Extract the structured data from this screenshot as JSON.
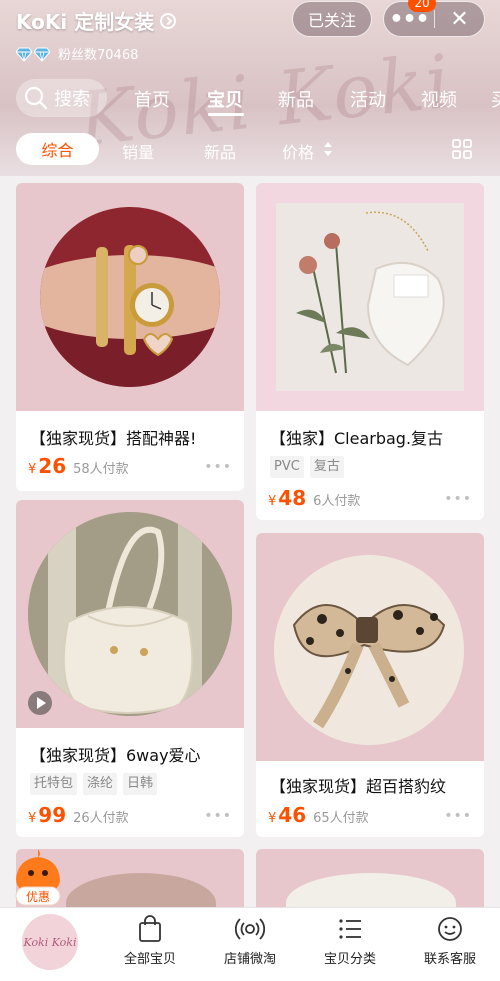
{
  "header": {
    "shop_name": "KoKi 定制女装",
    "follow_label": "已关注",
    "more_label": "•••",
    "badge_count": "20",
    "close_label": "✕",
    "fans_label": "粉丝数70468",
    "watermark": "Koki Koki"
  },
  "search": {
    "label": "搜索"
  },
  "nav_tabs": [
    "首页",
    "宝贝",
    "新品",
    "活动",
    "视频",
    "买"
  ],
  "active_tab": "宝贝",
  "sort": {
    "items": [
      "综合",
      "销量",
      "新品",
      "价格"
    ],
    "active": "综合"
  },
  "products": [
    {
      "title": "【独家现货】搭配神器!",
      "tags": [],
      "currency": "¥",
      "price": "26",
      "sold": "58人付款",
      "more": "•••"
    },
    {
      "title": "【独家】Clearbag.复古",
      "tags": [
        "PVC",
        "复古"
      ],
      "currency": "¥",
      "price": "48",
      "sold": "6人付款",
      "more": "•••"
    },
    {
      "title": "【独家现货】6way爱心",
      "tags": [
        "托特包",
        "涤纶",
        "日韩"
      ],
      "currency": "¥",
      "price": "99",
      "sold": "26人付款",
      "more": "•••"
    },
    {
      "title": "【独家现货】超百搭豹纹",
      "tags": [],
      "currency": "¥",
      "price": "46",
      "sold": "65人付款",
      "more": "•••"
    }
  ],
  "coupon": {
    "label": "优惠"
  },
  "bottom_bar": {
    "logo_text": "Koki Koki",
    "items": [
      "全部宝贝",
      "店铺微淘",
      "宝贝分类",
      "联系客服"
    ]
  },
  "colors": {
    "accent": "#ff5000",
    "card_pink": "#ecc9ce",
    "banner": "#dcc4c5"
  },
  "icons": [
    "info-arrow-icon",
    "more-icon",
    "close-icon",
    "diamond-icon",
    "search-icon",
    "sort-arrows-icon",
    "grid-view-icon",
    "video-play-icon",
    "bag-icon",
    "broadcast-icon",
    "list-icon",
    "customer-service-icon"
  ]
}
